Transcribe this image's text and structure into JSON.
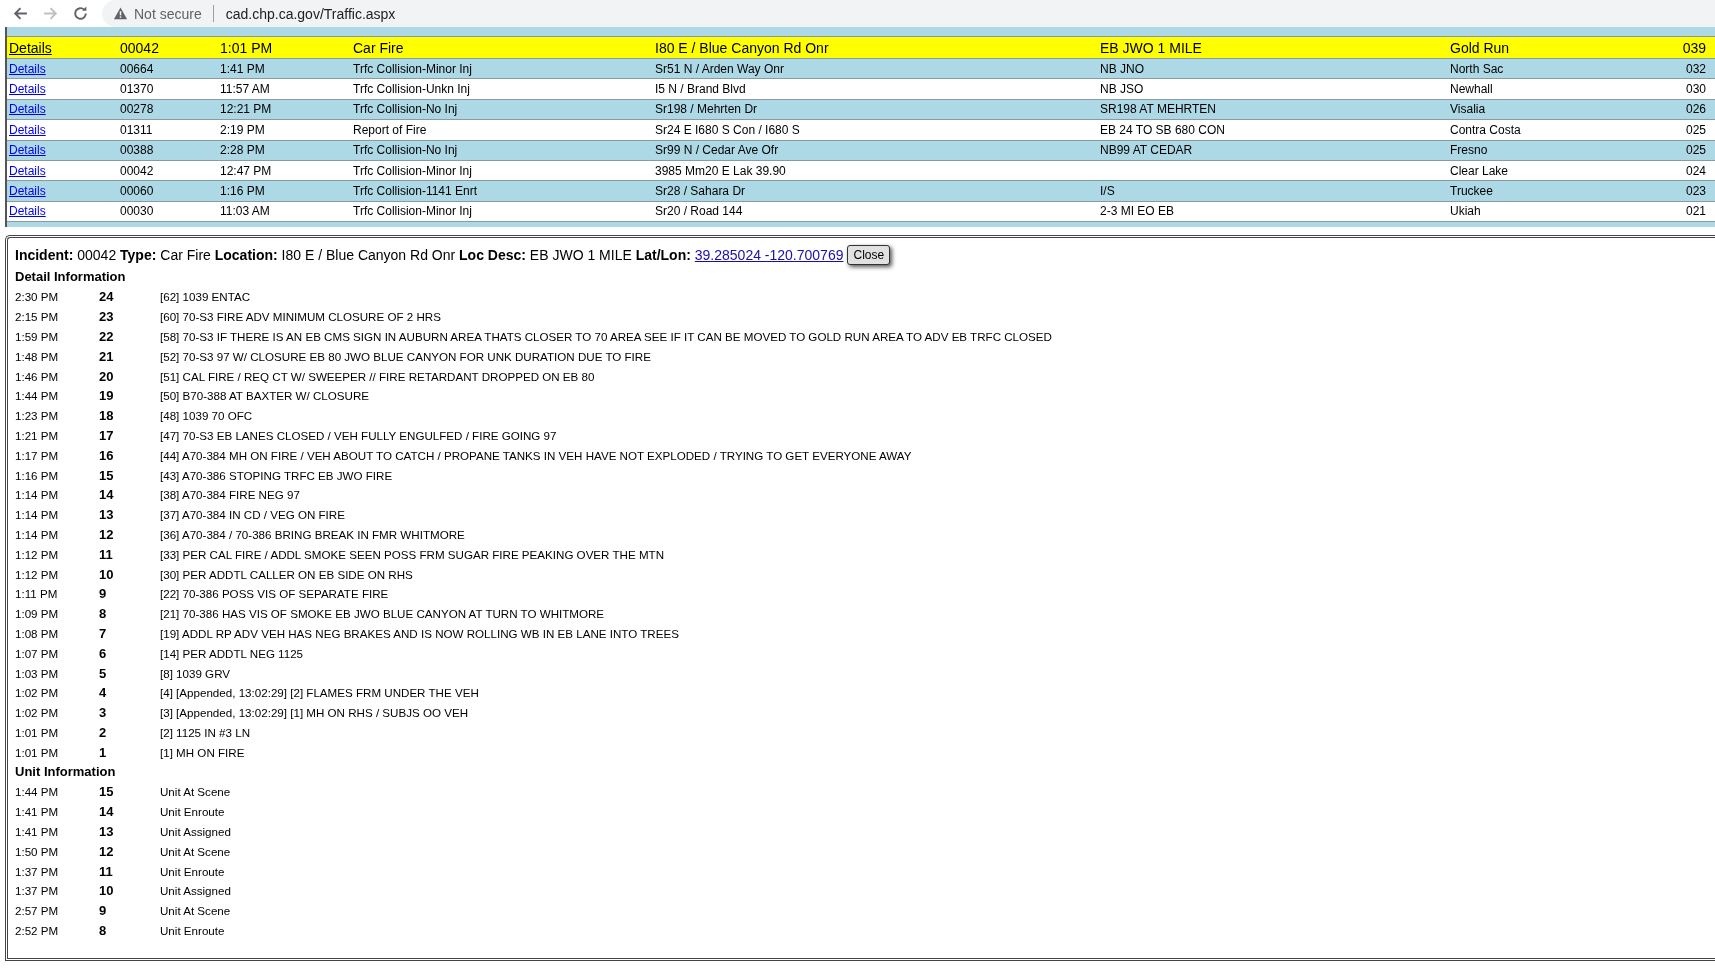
{
  "browser": {
    "security": "Not secure",
    "url": "cad.chp.ca.gov/Traffic.aspx"
  },
  "incidents": [
    {
      "link": "Details",
      "number": "00042",
      "time": "1:01 PM",
      "type": "Car Fire",
      "location": "I80 E / Blue Canyon Rd Onr",
      "loc_desc": "EB JWO 1 MILE",
      "area": "Gold Run",
      "code": "039",
      "selected": true
    },
    {
      "link": "Details",
      "number": "00664",
      "time": "1:41 PM",
      "type": "Trfc Collision-Minor Inj",
      "location": "Sr51 N / Arden Way Onr",
      "loc_desc": "NB JNO",
      "area": "North Sac",
      "code": "032",
      "selected": false
    },
    {
      "link": "Details",
      "number": "01370",
      "time": "11:57 AM",
      "type": "Trfc Collision-Unkn Inj",
      "location": "I5 N / Brand Blvd",
      "loc_desc": "NB JSO",
      "area": "Newhall",
      "code": "030",
      "selected": false
    },
    {
      "link": "Details",
      "number": "00278",
      "time": "12:21 PM",
      "type": "Trfc Collision-No Inj",
      "location": "Sr198 / Mehrten Dr",
      "loc_desc": "SR198 AT MEHRTEN",
      "area": "Visalia",
      "code": "026",
      "selected": false
    },
    {
      "link": "Details",
      "number": "01311",
      "time": "2:19 PM",
      "type": "Report of Fire",
      "location": "Sr24 E I680 S Con / I680 S",
      "loc_desc": "EB 24 TO SB 680 CON",
      "area": "Contra Costa",
      "code": "025",
      "selected": false
    },
    {
      "link": "Details",
      "number": "00388",
      "time": "2:28 PM",
      "type": "Trfc Collision-No Inj",
      "location": "Sr99 N / Cedar Ave Ofr",
      "loc_desc": "NB99 AT CEDAR",
      "area": "Fresno",
      "code": "025",
      "selected": false
    },
    {
      "link": "Details",
      "number": "00042",
      "time": "12:47 PM",
      "type": "Trfc Collision-Minor Inj",
      "location": "3985 Mm20 E Lak 39.90",
      "area": "Clear Lake",
      "code": "024",
      "selected": false
    },
    {
      "link": "Details",
      "number": "00060",
      "time": "1:16 PM",
      "type": "Trfc Collision-1141 Enrt",
      "location": "Sr28 / Sahara Dr",
      "loc_desc": "I/S",
      "area": "Truckee",
      "code": "023",
      "selected": false
    },
    {
      "link": "Details",
      "number": "00030",
      "time": "11:03 AM",
      "type": "Trfc Collision-Minor Inj",
      "location": "Sr20 / Road 144",
      "loc_desc": "2-3 MI EO EB",
      "area": "Ukiah",
      "code": "021",
      "selected": false
    }
  ],
  "detail": {
    "summary": "**Incident:** 00042 **Type:** Car Fire **Location:** I80 E / Blue Canyon Rd Onr **Loc Desc:** EB JWO 1 MILE **Lat/Lon:**",
    "coordinates_link": "39.285024 -120.700769",
    "close_button": "Close",
    "detail_heading": "Detail Information",
    "details": [
      {
        "time": "2:30 PM",
        "number": "24",
        "text": "[62] 1039 ENTAC"
      },
      {
        "time": "2:15 PM",
        "number": "23",
        "text": "[60] 70-S3 FIRE ADV MINIMUM CLOSURE OF 2 HRS"
      },
      {
        "time": "1:59 PM",
        "number": "22",
        "text": "[58] 70-S3 IF THERE IS AN EB CMS SIGN IN AUBURN AREA THATS CLOSER TO 70 AREA SEE IF IT CAN BE MOVED TO GOLD RUN AREA TO ADV EB TRFC CLOSED"
      },
      {
        "time": "1:48 PM",
        "number": "21",
        "text": "[52] 70-S3 97 W/ CLOSURE EB 80 JWO BLUE CANYON FOR UNK DURATION DUE TO FIRE"
      },
      {
        "time": "1:46 PM",
        "number": "20",
        "text": "[51] CAL FIRE / REQ CT W/ SWEEPER // FIRE RETARDANT DROPPED ON EB 80"
      },
      {
        "time": "1:44 PM",
        "number": "19",
        "text": "[50] B70-388 AT BAXTER W/ CLOSURE"
      },
      {
        "time": "1:23 PM",
        "number": "18",
        "text": "[48] 1039 70 OFC"
      },
      {
        "time": "1:21 PM",
        "number": "17",
        "text": "[47] 70-S3 EB LANES CLOSED / VEH FULLY ENGULFED / FIRE GOING 97"
      },
      {
        "time": "1:17 PM",
        "number": "16",
        "text": "[44] A70-384 MH ON FIRE / VEH ABOUT TO CATCH / PROPANE TANKS IN VEH HAVE NOT EXPLODED / TRYING TO GET EVERYONE AWAY"
      },
      {
        "time": "1:16 PM",
        "number": "15",
        "text": "[43] A70-386 STOPING TRFC EB JWO FIRE"
      },
      {
        "time": "1:14 PM",
        "number": "14",
        "text": "[38] A70-384 FIRE NEG 97"
      },
      {
        "time": "1:14 PM",
        "number": "13",
        "text": "[37] A70-384 IN CD / VEG ON FIRE"
      },
      {
        "time": "1:14 PM",
        "number": "12",
        "text": "[36] A70-384 / 70-386 BRING BREAK IN FMR WHITMORE"
      },
      {
        "time": "1:12 PM",
        "number": "11",
        "text": "[33] PER CAL FIRE / ADDL SMOKE SEEN POSS FRM SUGAR FIRE PEAKING OVER THE MTN"
      },
      {
        "time": "1:12 PM",
        "number": "10",
        "text": "[30] PER ADDTL CALLER ON EB SIDE ON RHS"
      },
      {
        "time": "1:11 PM",
        "number": "9",
        "text": "[22] 70-386 POSS VIS OF SEPARATE FIRE"
      },
      {
        "time": "1:09 PM",
        "number": "8",
        "text": "[21] 70-386 HAS VIS OF SMOKE EB JWO BLUE CANYON AT TURN TO WHITMORE"
      },
      {
        "time": "1:08 PM",
        "number": "7",
        "text": "[19] ADDL RP ADV VEH HAS NEG BRAKES AND IS NOW ROLLING WB IN EB LANE INTO TREES"
      },
      {
        "time": "1:07 PM",
        "number": "6",
        "text": "[14] PER ADDTL NEG 1125"
      },
      {
        "time": "1:03 PM",
        "number": "5",
        "text": "[8] 1039 GRV"
      },
      {
        "time": "1:02 PM",
        "number": "4",
        "text": "[4] [Appended, 13:02:29] [2] FLAMES FRM UNDER THE VEH"
      },
      {
        "time": "1:02 PM",
        "number": "3",
        "text": "[3] [Appended, 13:02:29] [1] MH ON RHS / SUBJS OO VEH"
      },
      {
        "time": "1:01 PM",
        "number": "2",
        "text": "[2] 1125 IN #3 LN"
      },
      {
        "time": "1:01 PM",
        "number": "1",
        "text": "[1] MH ON FIRE"
      }
    ],
    "unit_heading": "Unit Information",
    "units": [
      {
        "time": "1:44 PM",
        "number": "15",
        "text": "Unit At Scene"
      },
      {
        "time": "1:41 PM",
        "number": "14",
        "text": "Unit Enroute"
      },
      {
        "time": "1:41 PM",
        "number": "13",
        "text": "Unit Assigned"
      },
      {
        "time": "1:50 PM",
        "number": "12",
        "text": "Unit At Scene"
      },
      {
        "time": "1:37 PM",
        "number": "11",
        "text": "Unit Enroute"
      },
      {
        "time": "1:37 PM",
        "number": "10",
        "text": "Unit Assigned"
      },
      {
        "time": "2:57 PM",
        "number": "9",
        "text": "Unit At Scene"
      },
      {
        "time": "2:52 PM",
        "number": "8",
        "text": "Unit Enroute"
      }
    ]
  }
}
